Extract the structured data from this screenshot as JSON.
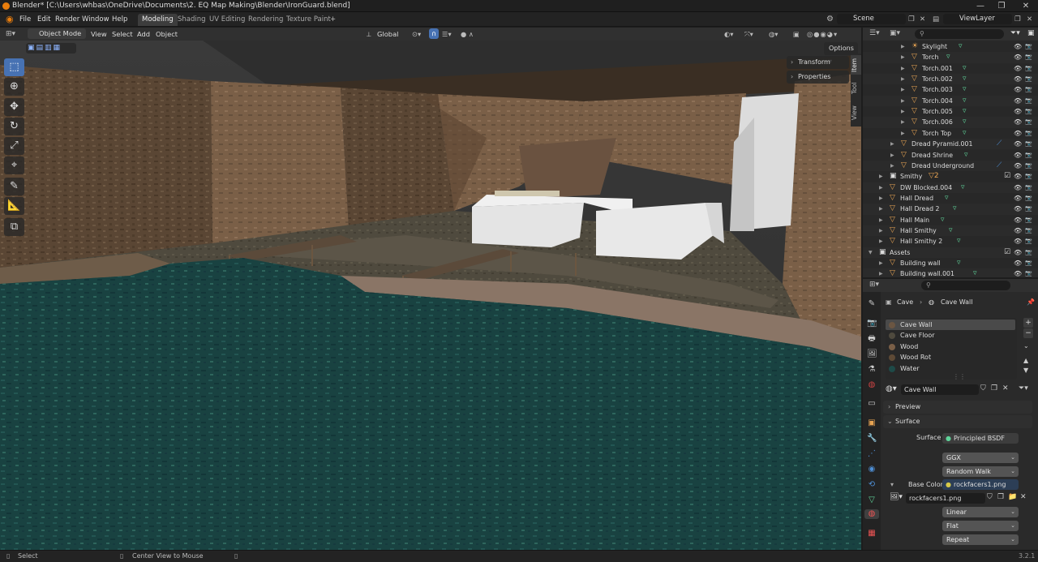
{
  "window": {
    "title": "Blender* [C:\\Users\\whbas\\OneDrive\\Documents\\2. EQ Map Making\\Blender\\IronGuard.blend]",
    "controls": [
      "—",
      "❐",
      "✕"
    ]
  },
  "menu": {
    "items": [
      "File",
      "Edit",
      "Render",
      "Window",
      "Help"
    ],
    "workspaces": [
      "Modeling",
      "Shading",
      "UV Editing",
      "Rendering",
      "Texture Paint"
    ],
    "active_workspace": "Modeling",
    "add_workspace": "+",
    "scene": "Scene",
    "view_layer": "ViewLayer"
  },
  "viewport_header": {
    "mode": "Object Mode",
    "menus": [
      "View",
      "Select",
      "Add",
      "Object"
    ],
    "transform_orientation": "Global",
    "options_label": "Options"
  },
  "npanel": {
    "buttons": [
      "Transform",
      "Properties"
    ],
    "tabs": [
      "Item",
      "Tool",
      "View"
    ]
  },
  "outliner": {
    "rows": [
      {
        "name": "Skylight",
        "kind": "light",
        "level": 3
      },
      {
        "name": "Torch",
        "kind": "mesh",
        "level": 3
      },
      {
        "name": "Torch.001",
        "kind": "mesh",
        "level": 3
      },
      {
        "name": "Torch.002",
        "kind": "mesh",
        "level": 3
      },
      {
        "name": "Torch.003",
        "kind": "mesh",
        "level": 3
      },
      {
        "name": "Torch.004",
        "kind": "mesh",
        "level": 3
      },
      {
        "name": "Torch.005",
        "kind": "mesh",
        "level": 3
      },
      {
        "name": "Torch.006",
        "kind": "mesh",
        "level": 3
      },
      {
        "name": "Torch Top",
        "kind": "mesh",
        "level": 3
      },
      {
        "name": "Dread Pyramid.001",
        "kind": "mesh",
        "level": 2
      },
      {
        "name": "Dread Shrine",
        "kind": "mesh",
        "level": 2
      },
      {
        "name": "Dread Underground",
        "kind": "mesh",
        "level": 2
      },
      {
        "name": "Smithy",
        "kind": "collection",
        "level": 1,
        "badge": "2"
      },
      {
        "name": "DW Blocked.004",
        "kind": "mesh",
        "level": 1
      },
      {
        "name": "Hall Dread",
        "kind": "mesh",
        "level": 1
      },
      {
        "name": "Hall Dread 2",
        "kind": "mesh",
        "level": 1
      },
      {
        "name": "Hall Main",
        "kind": "mesh",
        "level": 1
      },
      {
        "name": "Hall Smithy",
        "kind": "mesh",
        "level": 1
      },
      {
        "name": "Hall Smithy 2",
        "kind": "mesh",
        "level": 1
      },
      {
        "name": "Assets",
        "kind": "collection",
        "level": 0
      },
      {
        "name": "Building wall",
        "kind": "mesh",
        "level": 1
      },
      {
        "name": "Building wall.001",
        "kind": "mesh",
        "level": 1
      }
    ]
  },
  "properties": {
    "breadcrumb": [
      "Cave",
      "Cave Wall"
    ],
    "material_slots": [
      "Cave Wall",
      "Cave Floor",
      "Wood",
      "Wood Rot",
      "Water"
    ],
    "selected_slot": "Cave Wall",
    "material_name": "Cave Wall",
    "panels": {
      "preview": "Preview",
      "surface": "Surface"
    },
    "surface_label": "Surface",
    "surface_shader": "Principled BSDF",
    "distribution": "GGX",
    "subsurface": "Random Walk",
    "base_color_label": "Base Color",
    "base_color_texture": "rockfacers1.png",
    "image_name": "rockfacers1.png",
    "interpolation": "Linear",
    "projection": "Flat",
    "extension": "Repeat"
  },
  "status": {
    "left": "Select",
    "middle": "Center View to Mouse",
    "version": "3.2.1"
  },
  "colors": {
    "active_blue": "#4772b3",
    "object_orange": "#e8a453",
    "material_green": "#5fd49a",
    "texture_yellow": "#d6c949"
  }
}
